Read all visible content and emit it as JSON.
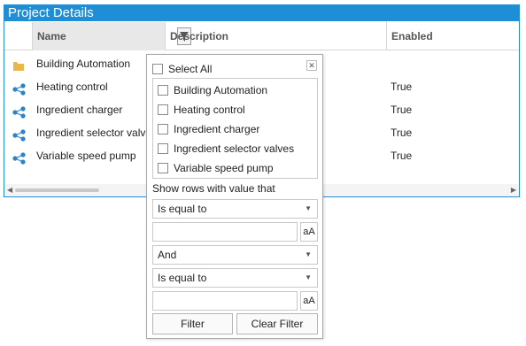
{
  "panel": {
    "title": "Project Details"
  },
  "columns": {
    "name": "Name",
    "description": "Description",
    "enabled": "Enabled"
  },
  "rows": [
    {
      "name": "Building Automation",
      "enabled": "",
      "icon": "folder-icon"
    },
    {
      "name": "Heating control",
      "enabled": "True",
      "icon": "module-icon"
    },
    {
      "name": "Ingredient charger",
      "enabled": "True",
      "icon": "module-icon"
    },
    {
      "name": "Ingredient selector valves",
      "enabled": "True",
      "icon": "module-icon"
    },
    {
      "name": "Variable speed pump",
      "enabled": "True",
      "icon": "module-icon"
    }
  ],
  "filter": {
    "select_all": "Select All",
    "items": [
      "Building Automation",
      "Heating control",
      "Ingredient charger",
      "Ingredient selector valves",
      "Variable speed pump"
    ],
    "show_rows_label": "Show rows with value that",
    "operator1": "Is equal to",
    "value1": "",
    "case_label1": "aA",
    "logic": "And",
    "operator2": "Is equal to",
    "value2": "",
    "case_label2": "aA",
    "filter_button": "Filter",
    "clear_button": "Clear Filter"
  },
  "colors": {
    "accent": "#1e8fd6",
    "folder": "#e8b64a",
    "module": "#2b84c9"
  }
}
